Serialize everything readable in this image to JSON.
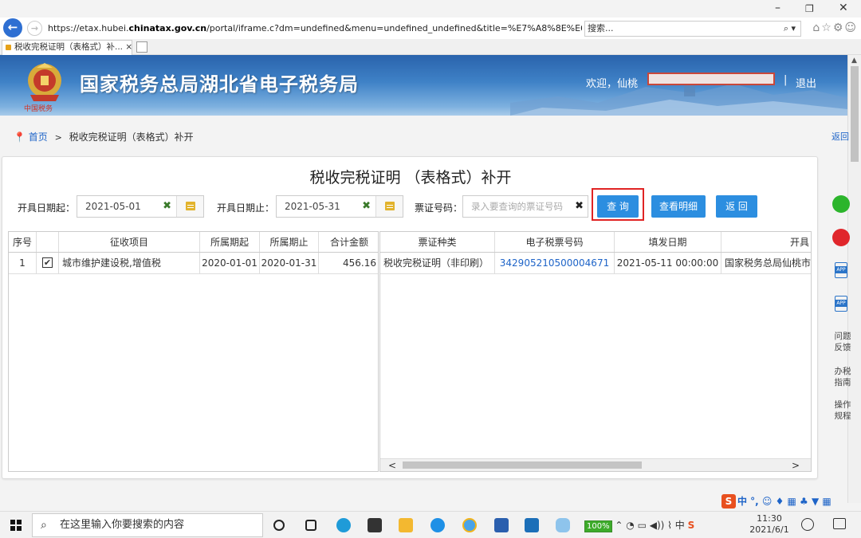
{
  "window": {
    "minimize": "–",
    "maximize": "❐",
    "close": "✕"
  },
  "browser": {
    "url_prefix": "https://etax.hubei.",
    "url_host": "chinatax.gov.cn",
    "url_rest": "/portal/iframe.c?dm=undefined&menu=undefined_undefined&title=%E7%A8%8E%E6%94% ▾ 🔒 ↻",
    "search_placeholder": "搜索...",
    "tab_title": "税收完税证明（表格式）补... ×"
  },
  "header": {
    "site_title": "国家税务总局湖北省电子税务局",
    "welcome": "欢迎，仙桃",
    "separator": "|",
    "logout": "退出"
  },
  "breadcrumb": {
    "home": "首页",
    "sep": ">",
    "current": "税收完税证明（表格式）补开"
  },
  "back_link": "返回",
  "panel": {
    "title": "税收完税证明 （表格式）补开",
    "start_label": "开具日期起：",
    "start_value": "2021-05-01",
    "end_label": "开具日期止：",
    "end_value": "2021-05-31",
    "ticket_label": "票证号码：",
    "ticket_placeholder": "录入要查询的票证号码",
    "clear_icon": "✖",
    "query_button": "查 询",
    "detail_button": "查看明细",
    "back_button": "返 回"
  },
  "table_left": {
    "headers": [
      "序号",
      "",
      "征收项目",
      "所属期起",
      "所属期止",
      "合计金额"
    ],
    "rows": [
      [
        "1",
        "✔",
        "城市维护建设税,增值税",
        "2020-01-01",
        "2020-01-31",
        "456.16"
      ]
    ]
  },
  "table_right": {
    "headers": [
      "票证种类",
      "电子税票号码",
      "填发日期",
      "开具"
    ],
    "rows": [
      [
        "税收完税证明（非印刷）",
        "342905210500004671",
        "2021-05-11 00:00:00",
        "国家税务总局仙桃市税"
      ]
    ]
  },
  "scroll_arrows": {
    "left": "<",
    "right": ">"
  },
  "sidebar": {
    "feedback": "问题反馈",
    "guide": "办税指南",
    "rules": "操作规程",
    "app": "APP"
  },
  "ime": {
    "logo": "S",
    "rest": "中 °, ☺ ♦ ▦ ♣ ▼ ▦"
  },
  "taskbar": {
    "search_text": "在这里输入你要搜索的内容",
    "battery": "100%",
    "tray_icons": "⌃ ◔ ▭ ◀)) ⌇ 中 ",
    "time": "11:30",
    "date": "2021/6/1"
  },
  "colors": {
    "accent": "#2c8ee0",
    "link": "#1e64c8",
    "highlight": "#e02424"
  }
}
